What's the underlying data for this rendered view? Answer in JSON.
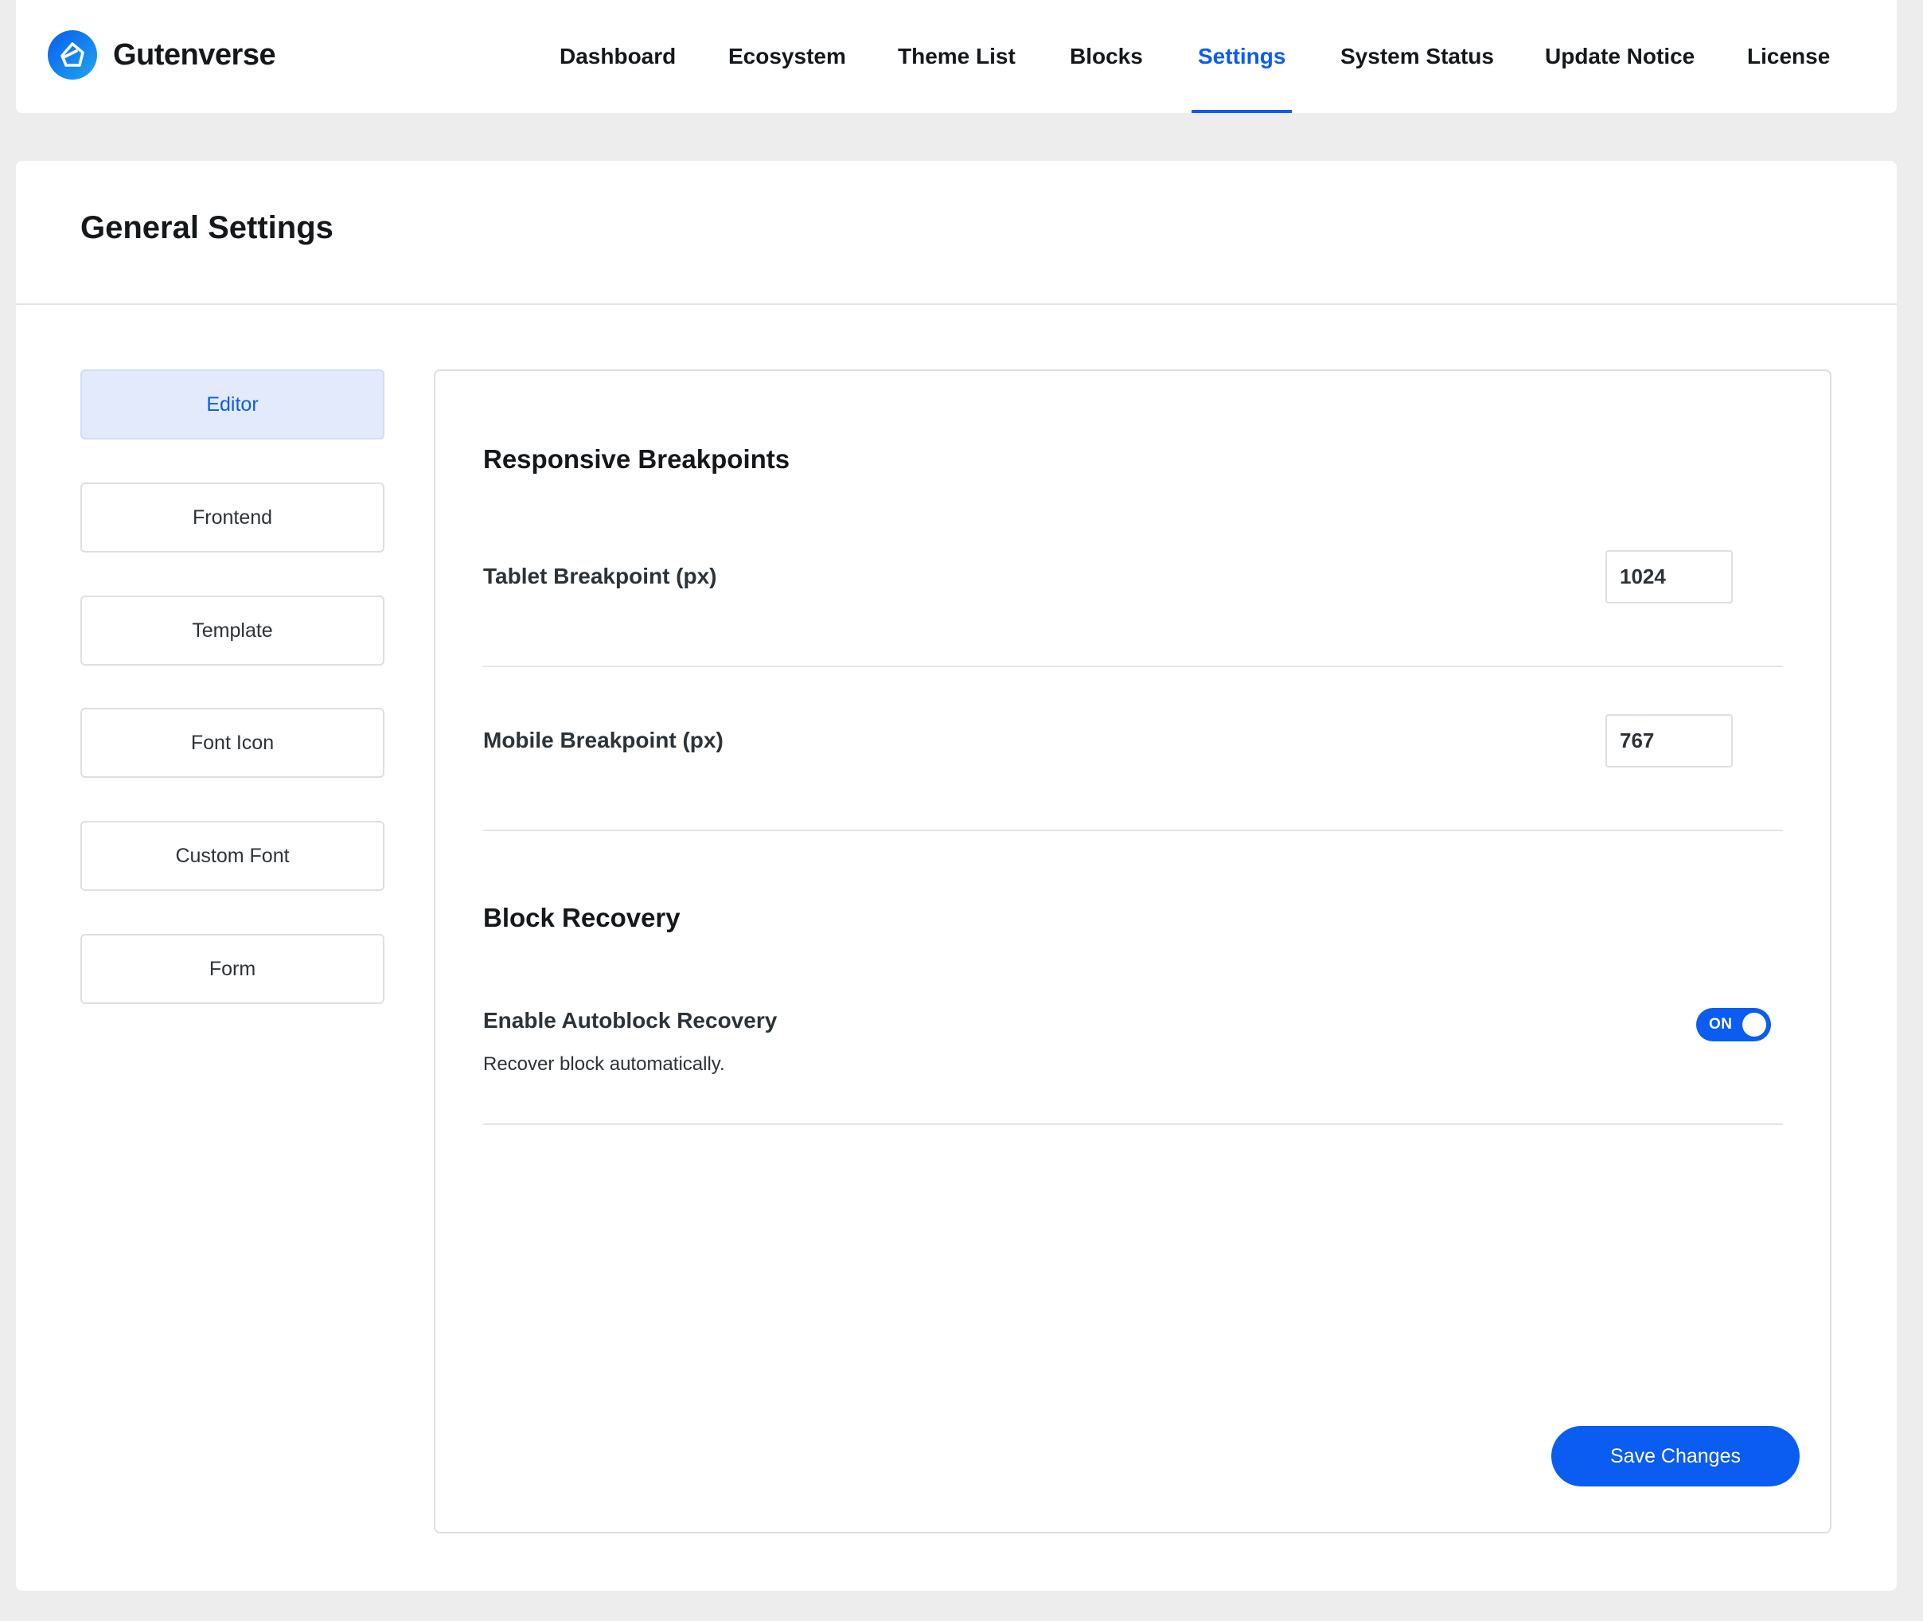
{
  "brand": {
    "name": "Gutenverse",
    "logo_icon": "gutenverse-logo-icon",
    "logo_gradient": [
      "#0a5cf0",
      "#1fa6ee"
    ]
  },
  "nav": {
    "items": [
      {
        "label": "Dashboard",
        "active": false
      },
      {
        "label": "Ecosystem",
        "active": false
      },
      {
        "label": "Theme List",
        "active": false
      },
      {
        "label": "Blocks",
        "active": false
      },
      {
        "label": "Settings",
        "active": true
      },
      {
        "label": "System Status",
        "active": false
      },
      {
        "label": "Update Notice",
        "active": false
      },
      {
        "label": "License",
        "active": false
      }
    ]
  },
  "page": {
    "title": "General Settings"
  },
  "sidebar": {
    "items": [
      {
        "label": "Editor",
        "active": true
      },
      {
        "label": "Frontend",
        "active": false
      },
      {
        "label": "Template",
        "active": false
      },
      {
        "label": "Font Icon",
        "active": false
      },
      {
        "label": "Custom Font",
        "active": false
      },
      {
        "label": "Form",
        "active": false
      }
    ]
  },
  "content": {
    "breakpoints": {
      "title": "Responsive Breakpoints",
      "tablet": {
        "label": "Tablet Breakpoint (px)",
        "value": "1024"
      },
      "mobile": {
        "label": "Mobile Breakpoint (px)",
        "value": "767"
      }
    },
    "recovery": {
      "title": "Block Recovery",
      "autoblock": {
        "label": "Enable Autoblock Recovery",
        "description": "Recover block automatically.",
        "toggle_text": "ON",
        "enabled": true
      }
    },
    "save_label": "Save Changes"
  },
  "colors": {
    "accent": "#0b5cf0",
    "active_tab_bg": "#e3eafb",
    "page_bg": "#ededed",
    "border": "#dcdfe3"
  }
}
